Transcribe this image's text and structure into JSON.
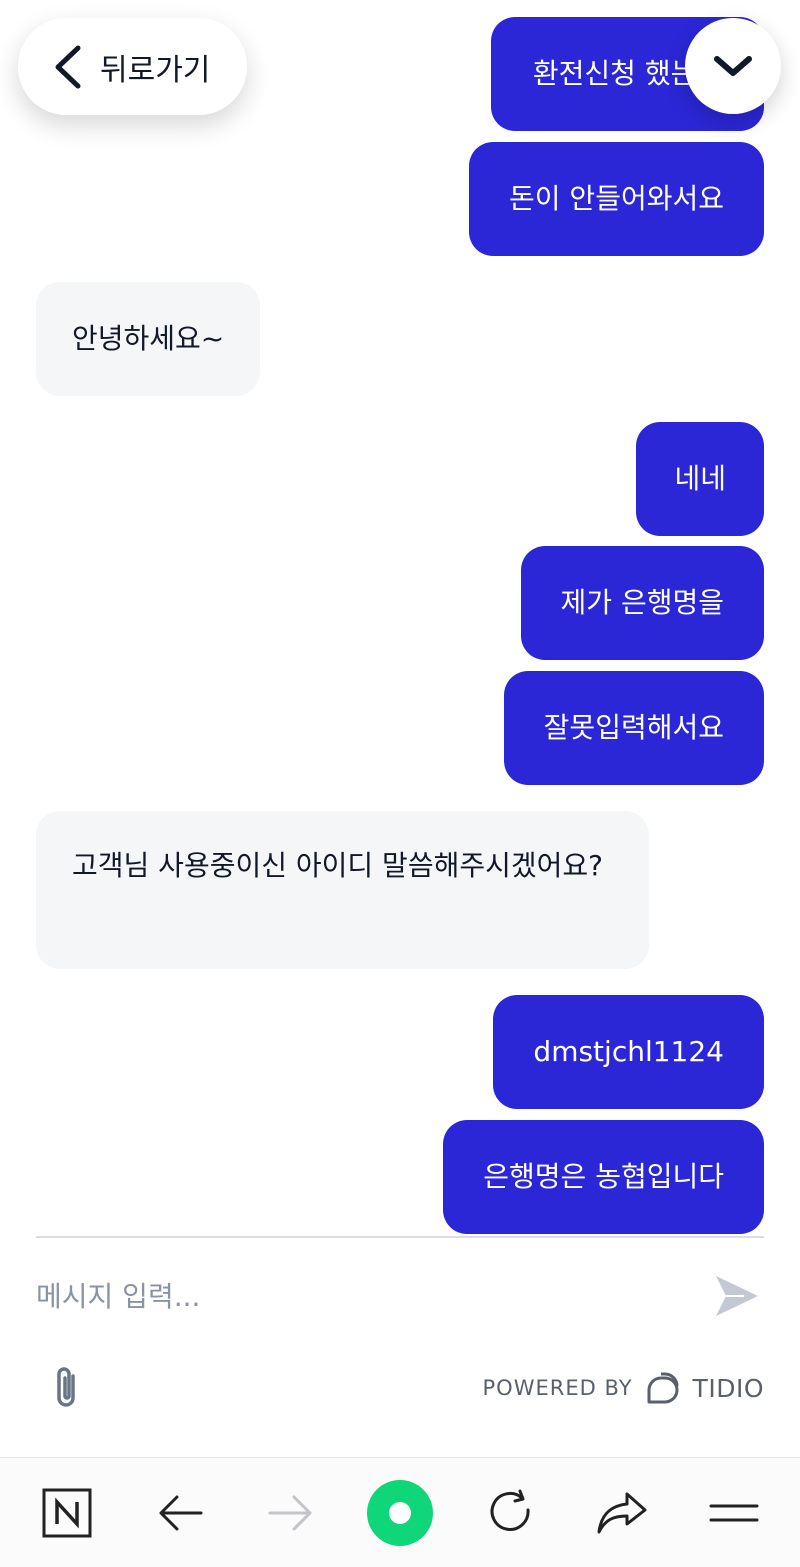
{
  "header": {
    "back_label": "뒤로가기"
  },
  "messages": [
    {
      "side": "out",
      "text": "환전신청 했는데"
    },
    {
      "side": "out",
      "text": "돈이 안들어와서요"
    },
    {
      "side": "in",
      "text": "안녕하세요~"
    },
    {
      "side": "out",
      "text": "네네"
    },
    {
      "side": "out",
      "text": "제가 은행명을"
    },
    {
      "side": "out",
      "text": "잘못입력해서요"
    },
    {
      "side": "in",
      "text": "고객님 사용중이신 아이디 말씀해주시겠어요?"
    },
    {
      "side": "out",
      "text": "dmstjchl1124"
    },
    {
      "side": "out",
      "text": "은행명은 농협입니다"
    }
  ],
  "composer": {
    "placeholder": "메시지 입력...",
    "value": ""
  },
  "footer": {
    "powered_by": "POWERED BY",
    "brand": "TIDIO"
  },
  "browser_bar": {
    "home_icon": "naver-n-icon",
    "back_icon": "arrow-left-icon",
    "forward_icon": "arrow-right-icon",
    "center_icon": "green-circle-icon",
    "reload_icon": "refresh-icon",
    "share_icon": "share-icon",
    "menu_icon": "hamburger-menu-icon"
  },
  "colors": {
    "outgoing_bubble": "#2b27d6",
    "incoming_bubble": "#f4f6f8",
    "accent_green": "#10d67a"
  }
}
